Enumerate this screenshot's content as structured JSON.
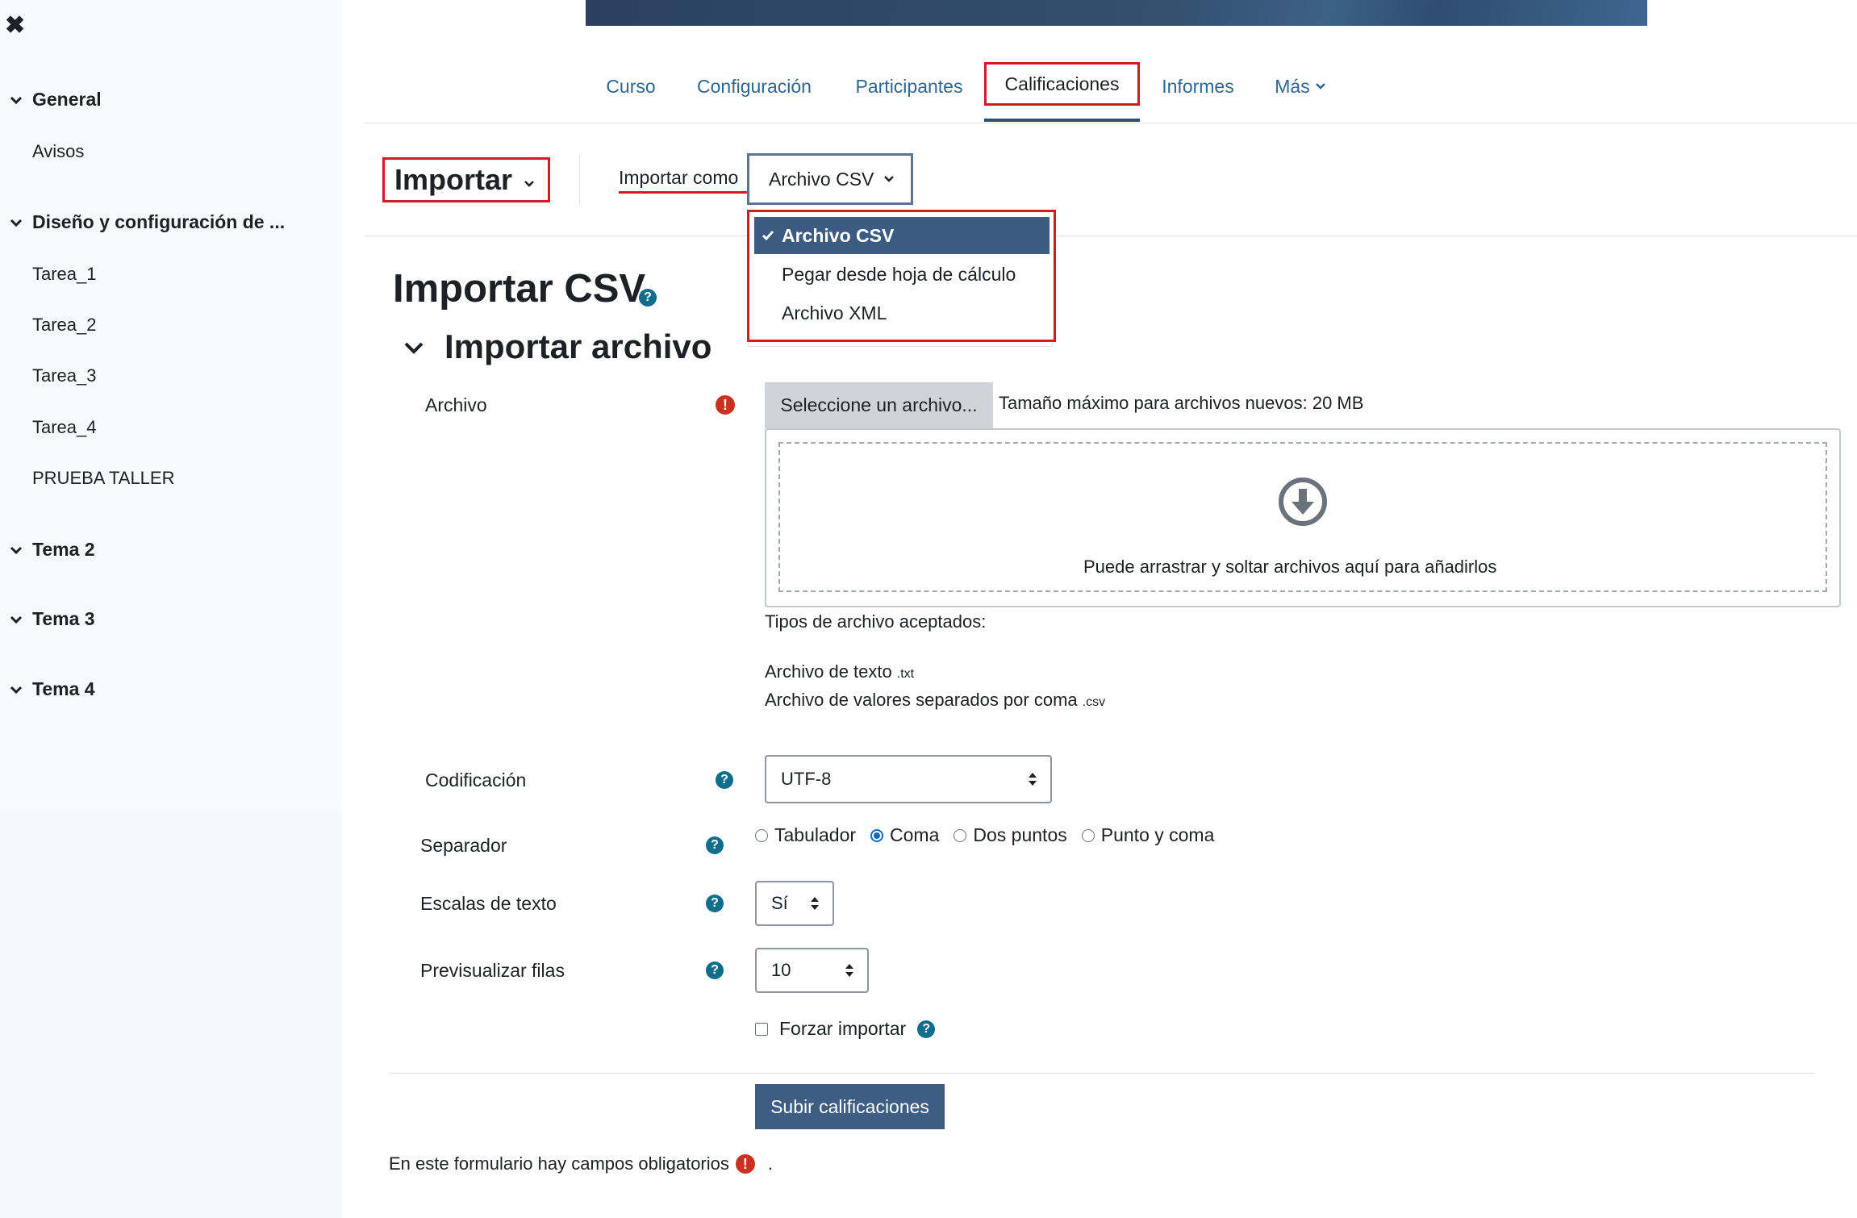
{
  "sidebar": {
    "sections": [
      {
        "label": "General"
      },
      {
        "label": "Diseño y configuración de ..."
      },
      {
        "label": "Tema 2"
      },
      {
        "label": "Tema 3"
      },
      {
        "label": "Tema 4"
      }
    ],
    "items": [
      "Avisos",
      "Tarea_1",
      "Tarea_2",
      "Tarea_3",
      "Tarea_4",
      "PRUEBA TALLER"
    ]
  },
  "nav": {
    "tabs": [
      "Curso",
      "Configuración",
      "Participantes",
      "Calificaciones",
      "Informes",
      "Más"
    ],
    "active": "Calificaciones"
  },
  "tertiary": {
    "importar": "Importar",
    "import_as_label": "Importar como",
    "import_as_value": "Archivo CSV",
    "menu": [
      "Archivo CSV",
      "Pegar desde hoja de cálculo",
      "Archivo XML"
    ],
    "menu_selected": "Archivo CSV"
  },
  "page": {
    "title": "Importar CSV",
    "section": "Importar archivo"
  },
  "form": {
    "file_label": "Archivo",
    "file_button": "Seleccione un archivo...",
    "max_size": "Tamaño máximo para archivos nuevos: 20 MB",
    "drop_text": "Puede arrastrar y soltar archivos aquí para añadirlos",
    "accepted_title": "Tipos de archivo aceptados:",
    "accepted_types": [
      {
        "name": "Archivo de texto",
        "ext": ".txt"
      },
      {
        "name": "Archivo de valores separados por coma",
        "ext": ".csv"
      }
    ],
    "encoding_label": "Codificación",
    "encoding_value": "UTF-8",
    "separator_label": "Separador",
    "separator_options": [
      "Tabulador",
      "Coma",
      "Dos puntos",
      "Punto y coma"
    ],
    "separator_selected": "Coma",
    "text_scales_label": "Escalas de texto",
    "text_scales_value": "Sí",
    "preview_rows_label": "Previsualizar filas",
    "preview_rows_value": "10",
    "force_import_label": "Forzar importar",
    "submit": "Subir calificaciones",
    "required_note": "En este formulario hay campos obligatorios",
    "required_note_end": "."
  },
  "colors": {
    "primary": "#0f6cbf",
    "nav_link": "#2e6791",
    "highlight_red": "#d61a25",
    "submit_bg": "#3d5d82",
    "required": "#ca3120"
  },
  "icons": [
    "close-icon",
    "chevron-down-icon",
    "check-icon",
    "help-icon",
    "required-icon",
    "download-arrow-icon",
    "select-arrows-icon"
  ]
}
